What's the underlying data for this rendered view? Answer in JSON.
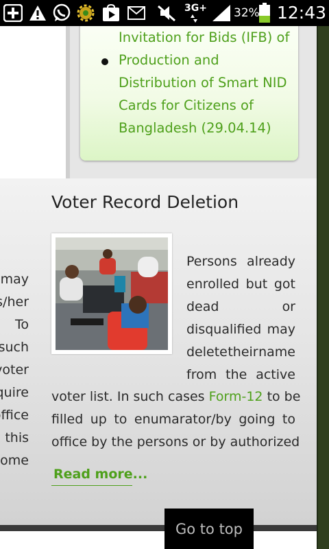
{
  "status_bar": {
    "battery_percent": "32%",
    "network": "3G+",
    "time": "12:43",
    "icons": [
      "add-icon",
      "warning-icon",
      "whatsapp-icon",
      "gear-icon",
      "play-store-icon",
      "mail-icon",
      "mute-icon",
      "network-3g-icon",
      "signal-icon",
      "battery-icon"
    ]
  },
  "notice": {
    "lines": [
      "Invitation for Bids (IFB) of",
      "Production and",
      "Distribution of Smart NID",
      "Cards for Citizens of",
      "Bangladesh (29.04.14)"
    ]
  },
  "section": {
    "title": "Voter Record Deletion",
    "image_alt": "People working at computers",
    "wrapped_lines": [
      [
        "Persons",
        "already"
      ],
      [
        "enrolled",
        "but",
        "got"
      ],
      [
        "dead",
        "or"
      ],
      [
        "disqualified",
        "may"
      ],
      [
        "delete",
        "their",
        "name"
      ],
      [
        "from",
        "the",
        "active"
      ]
    ],
    "line7_before": "voter list. In such cases ",
    "form_link": "Form-12",
    "line7_after": " to be",
    "line8": [
      "filled",
      "up",
      "to",
      "enumarator/by",
      "going",
      "to"
    ],
    "line9": "office by the persons or by authorized",
    "read_more": "Read more..."
  },
  "left_fragments": [
    "may",
    "s/her",
    "To",
    "such",
    "voter",
    "quire",
    "office",
    "this",
    "some"
  ],
  "go_to_top": "Go to top",
  "colors": {
    "accent_green": "#4ea01b",
    "rail": "#2f3f1e"
  }
}
